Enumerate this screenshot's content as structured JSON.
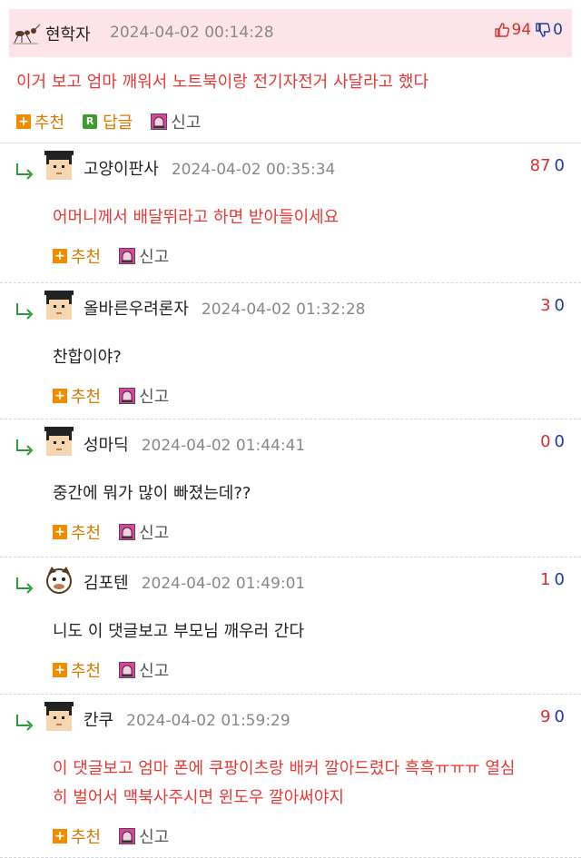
{
  "best_comment": {
    "nickname": "현학자",
    "date": "2024-04-02 00:14:28",
    "upvotes": "94",
    "downvotes": "0",
    "text": "이거 보고 엄마 깨워서 노트북이랑 전기자전거 사달라고 했다",
    "actions": {
      "recommend": "추천",
      "reply": "답글",
      "report": "신고"
    }
  },
  "replies": [
    {
      "nickname": "고양이판사",
      "date": "2024-04-02 00:35:34",
      "upvotes": "87",
      "downvotes": "0",
      "lines": [
        "어머니께서 배달뛰라고 하면 받아들이세요"
      ],
      "style": "red",
      "avatar": "pixel-face"
    },
    {
      "nickname": "올바른우려론자",
      "date": "2024-04-02 01:32:28",
      "upvotes": "3",
      "downvotes": "0",
      "lines": [
        "찬합이야?"
      ],
      "style": "dark",
      "avatar": "pixel-face"
    },
    {
      "nickname": "성마딕",
      "date": "2024-04-02 01:44:41",
      "upvotes": "0",
      "downvotes": "0",
      "lines": [
        "중간에 뭐가 많이 빠졌는데??"
      ],
      "style": "dark",
      "avatar": "pixel-face"
    },
    {
      "nickname": "김포텐",
      "date": "2024-04-02 01:49:01",
      "upvotes": "1",
      "downvotes": "0",
      "lines": [
        "니도 이 댓글보고 부모님 깨우러 간다"
      ],
      "style": "dark",
      "avatar": "round-face"
    },
    {
      "nickname": "칸쿠",
      "date": "2024-04-02 01:59:29",
      "upvotes": "9",
      "downvotes": "0",
      "lines": [
        "이 댓글보고 엄마 폰에 쿠팡이츠랑 배커 깔아드렸다 흑흑ㅠㅠㅠ 열심",
        "히 벌어서 맥북사주시면 윈도우 깔아써야지"
      ],
      "style": "red",
      "avatar": "pixel-face"
    }
  ],
  "reply_actions": {
    "recommend": "추천",
    "report": "신고"
  },
  "colors": {
    "best_bg": "#fde4e8",
    "red_text": "#e53935",
    "up": "#d32f2f",
    "down": "#1e3a9c",
    "action": "#d97a00",
    "arrow": "#2e9b3a"
  }
}
